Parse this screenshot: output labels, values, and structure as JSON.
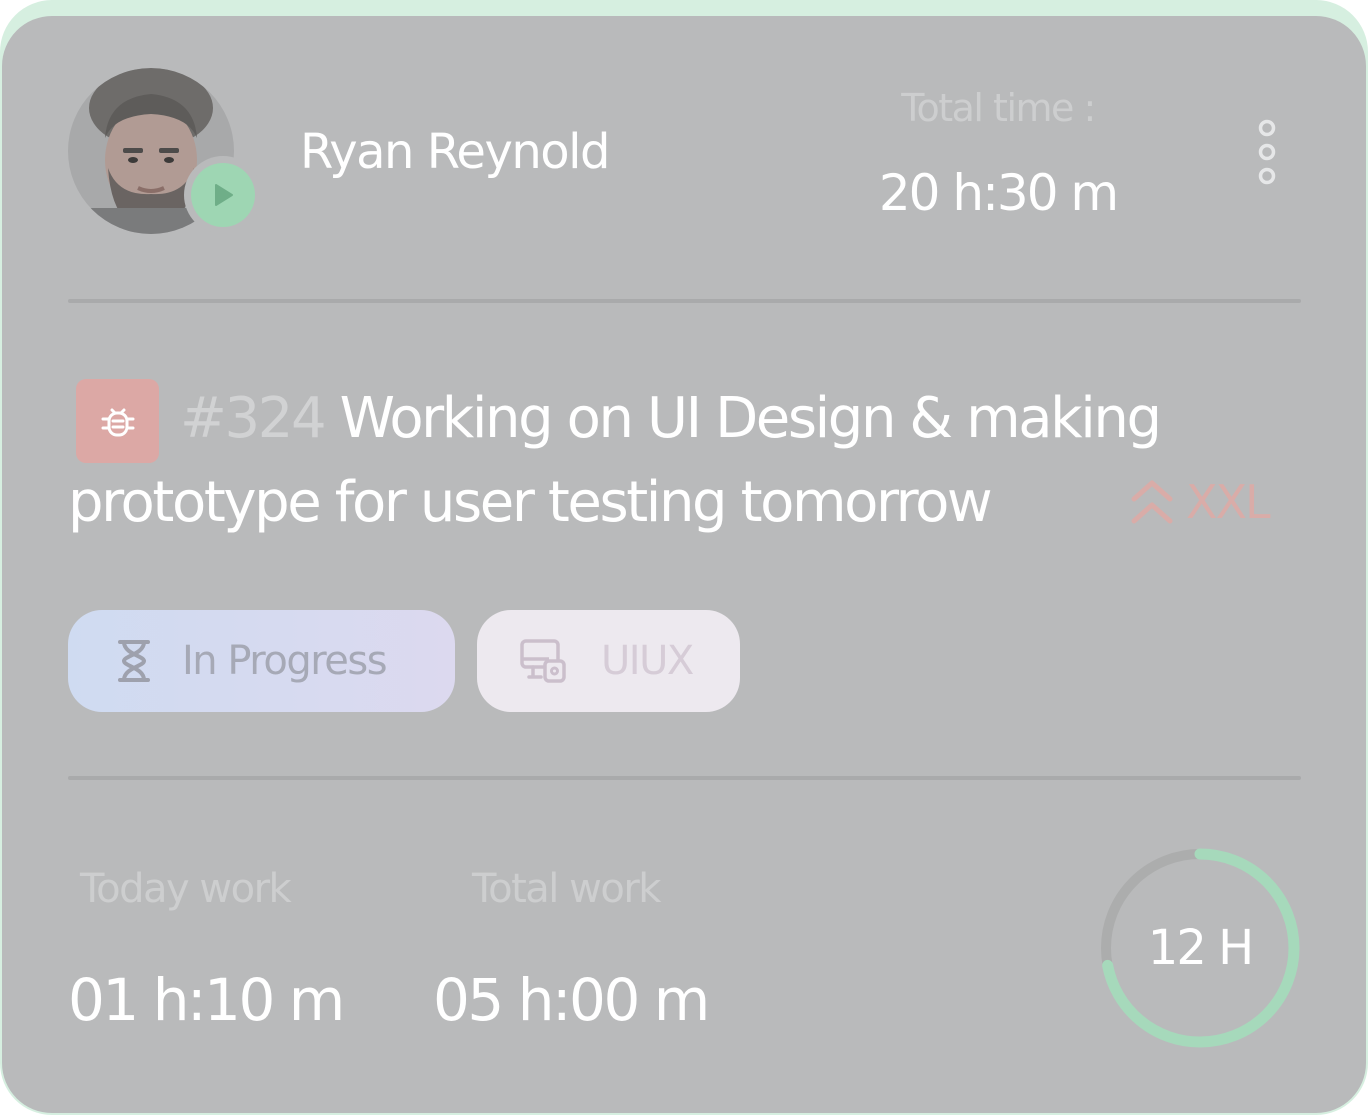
{
  "user": {
    "name": "Ryan Reynold"
  },
  "total_time": {
    "label": "Total time :",
    "value": "20 h:30 m"
  },
  "task": {
    "id": "#324",
    "title_line1": "Working on UI Design & making",
    "title_line2": "prototype for user testing tomorrow",
    "priority": "XXL"
  },
  "chips": {
    "status": "In Progress",
    "category": "UIUX"
  },
  "stats": {
    "today_label": "Today work",
    "today_value": "01 h:10 m",
    "total_label": "Total work",
    "total_value": "05 h:00 m"
  },
  "progress_ring": {
    "label": "12 H",
    "fraction": 0.72
  },
  "colors": {
    "card_bg": "#b9babb",
    "accent_green": "#9ed6b3",
    "bug_red": "#dca8a5",
    "priority_red": "#d9aca8"
  },
  "icons": {
    "avatar": "user-photo",
    "status": "play-icon",
    "menu": "more-vertical-icon",
    "bug": "bug-icon",
    "priority": "chevrons-up-icon",
    "status_chip": "hourglass-icon",
    "category_chip": "monitor-lock-icon"
  }
}
